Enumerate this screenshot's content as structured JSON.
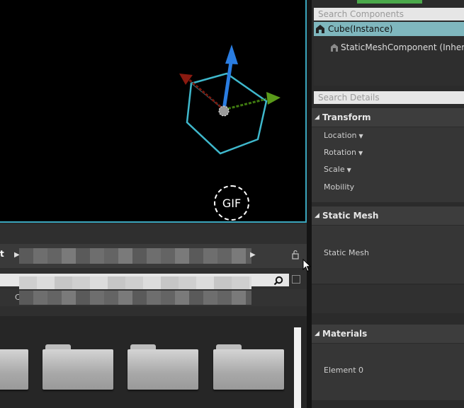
{
  "viewport": {
    "badge": "GIF"
  },
  "content_browser": {
    "crumb_text": "t",
    "filter_letter": "C"
  },
  "details": {
    "search_components_placeholder": "Search Components",
    "components": [
      {
        "label": "Cube(Instance)"
      },
      {
        "label": "StaticMeshComponent (Inherited"
      }
    ],
    "search_details_placeholder": "Search Details",
    "transform": {
      "title": "Transform",
      "location": "Location",
      "rotation": "Rotation",
      "scale": "Scale",
      "mobility": "Mobility"
    },
    "static_mesh": {
      "title": "Static Mesh",
      "prop": "Static Mesh"
    },
    "materials": {
      "title": "Materials",
      "element": "Element 0"
    }
  },
  "colors": {
    "selection": "#7fb7be",
    "viewport_border": "#3aa6bd",
    "gizmo_z": "#2a7de1",
    "gizmo_y": "#5a9a1a",
    "gizmo_x": "#8a1a10"
  }
}
